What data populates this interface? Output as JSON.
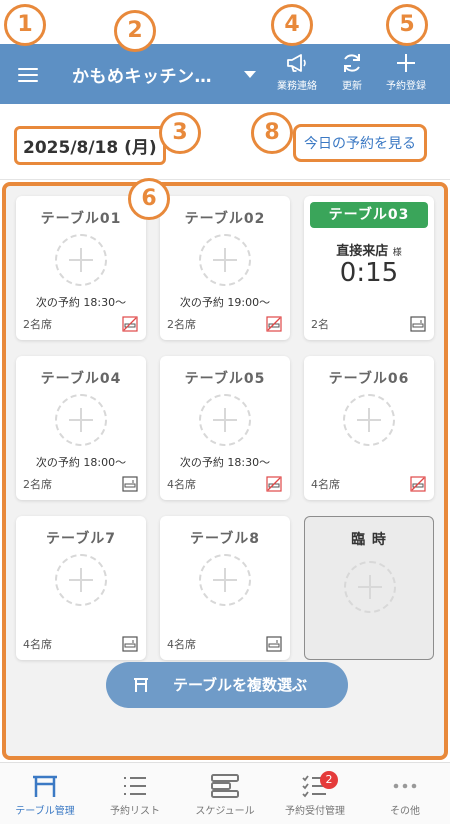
{
  "header": {
    "store_name": "かもめキッチン…",
    "actions": [
      {
        "label": "業務連絡",
        "icon": "megaphone-icon"
      },
      {
        "label": "更新",
        "icon": "refresh-icon"
      },
      {
        "label": "予約登録",
        "icon": "plus-icon"
      }
    ]
  },
  "date_row": {
    "date": "2025/8/18 (月)",
    "today_link": "今日の予約を見る"
  },
  "tables": [
    {
      "name": "テーブル01",
      "next": "次の予約 18:30～",
      "seats": "2名席",
      "smoking": "non-smoking"
    },
    {
      "name": "テーブル02",
      "next": "次の予約 19:00～",
      "seats": "2名席",
      "smoking": "non-smoking"
    },
    {
      "name": "テーブル03",
      "guest": "直接来店",
      "guest_suffix": "様",
      "elapsed": "0:15",
      "seats": "2名",
      "smoking": "smoking",
      "status": "occupied"
    },
    {
      "name": "テーブル04",
      "next": "次の予約 18:00～",
      "seats": "2名席",
      "smoking": "smoking"
    },
    {
      "name": "テーブル05",
      "next": "次の予約 18:30～",
      "seats": "4名席",
      "smoking": "non-smoking"
    },
    {
      "name": "テーブル06",
      "seats": "4名席",
      "smoking": "non-smoking"
    },
    {
      "name": "テーブル7",
      "seats": "4名席",
      "smoking": "smoking"
    },
    {
      "name": "テーブル8",
      "seats": "4名席",
      "smoking": "smoking"
    },
    {
      "name": "臨 時"
    }
  ],
  "multi_select_button": "テーブルを複数選ぶ",
  "bottom_nav": [
    {
      "label": "テーブル管理",
      "icon": "table-icon",
      "active": true
    },
    {
      "label": "予約リスト",
      "icon": "list-icon"
    },
    {
      "label": "スケジュール",
      "icon": "schedule-icon"
    },
    {
      "label": "予約受付管理",
      "icon": "checklist-icon",
      "badge": "2"
    },
    {
      "label": "その他",
      "icon": "more-icon"
    }
  ],
  "annotations": [
    "1",
    "2",
    "3",
    "4",
    "5",
    "6",
    "8"
  ],
  "colors": {
    "header": "#5d90c4",
    "accent": "#e8893b",
    "occupied": "#3aa55a",
    "link": "#3b79c4",
    "badge": "#e53b3b"
  }
}
